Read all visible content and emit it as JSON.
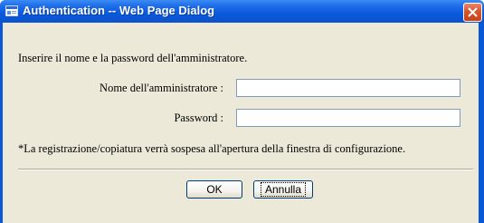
{
  "window": {
    "title": "Authentication -- Web Page Dialog",
    "title_icon": "web-page-dialog-icon",
    "close_icon": "close-icon",
    "colors": {
      "titlebar": "#0a59dc",
      "client_background": "#ece9d8",
      "close_button": "#d9542b"
    }
  },
  "form": {
    "intro_text": "Inserire il nome e la password dell'amministratore.",
    "admin_label": "Nome dell'amministratore :",
    "admin_value": "",
    "password_label": "Password :",
    "password_value": "",
    "note_text": "*La registrazione/copiatura verrà sospesa all'apertura della finestra di configurazione."
  },
  "buttons": {
    "ok_label": "OK",
    "cancel_label": "Annulla"
  }
}
